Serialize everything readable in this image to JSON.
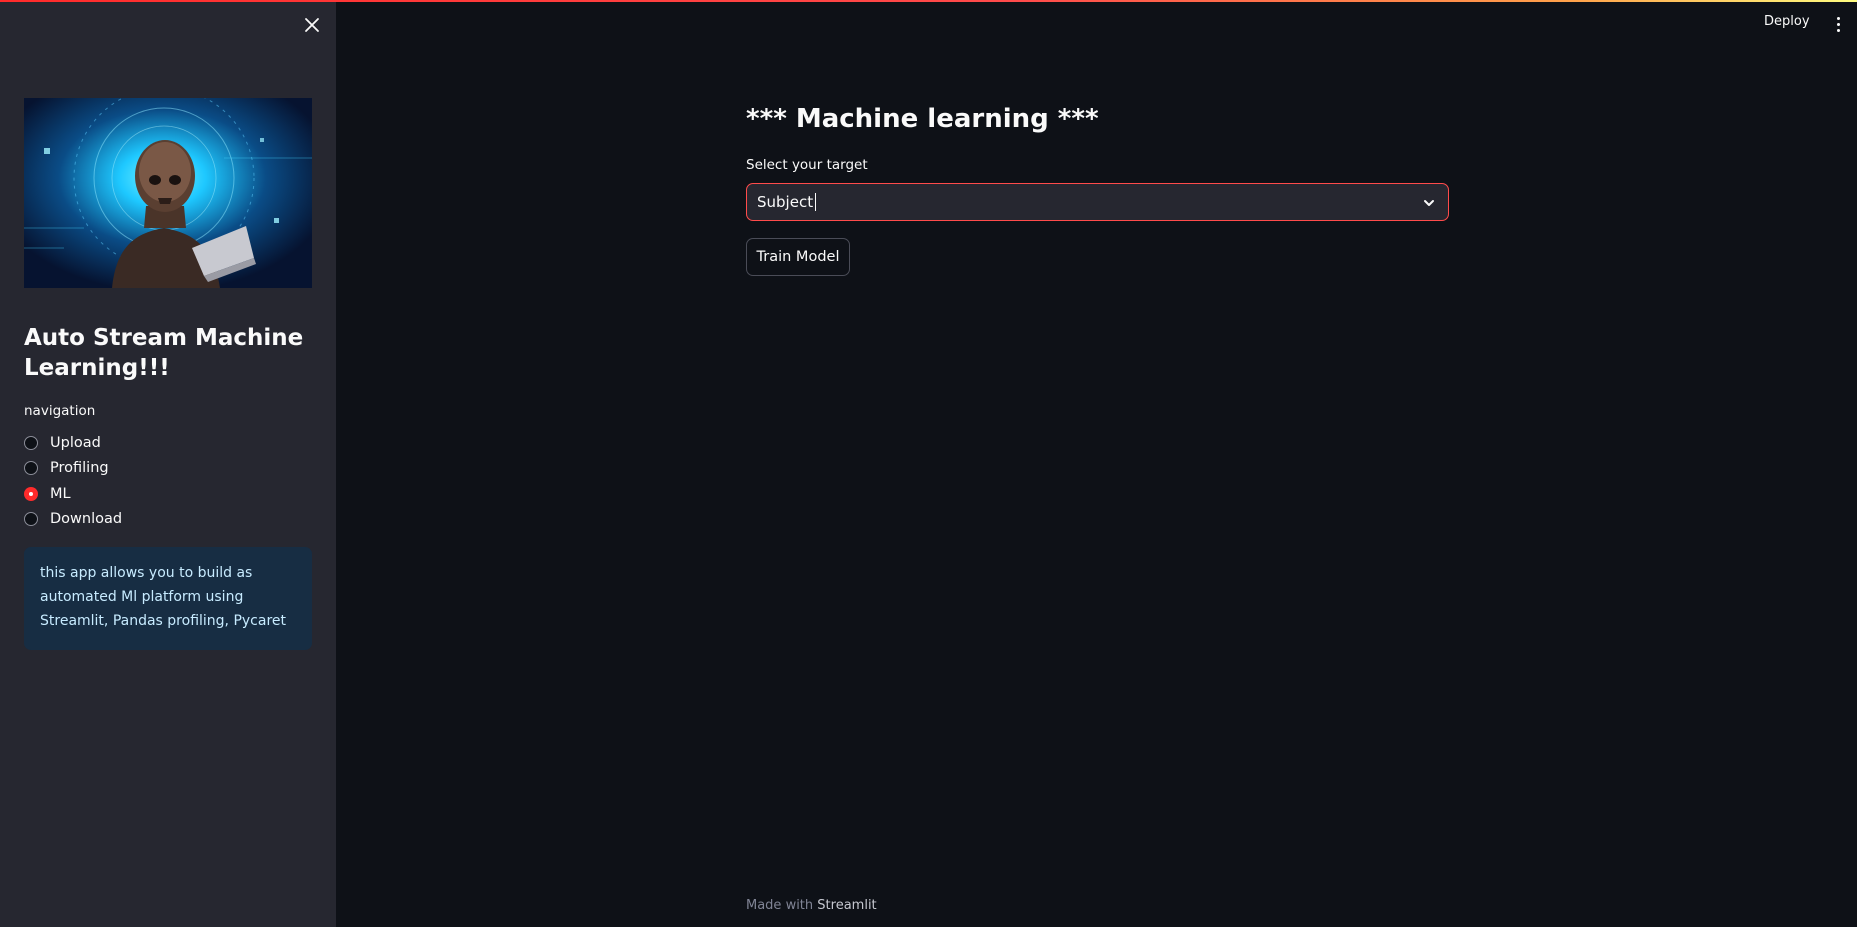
{
  "sidebar": {
    "title": "Auto Stream Machine Learning!!!",
    "nav_label": "navigation",
    "radio_options": [
      {
        "label": "Upload",
        "selected": false
      },
      {
        "label": "Profiling",
        "selected": false
      },
      {
        "label": "ML",
        "selected": true
      },
      {
        "label": "Download",
        "selected": false
      }
    ],
    "info_text": "this app allows you to build as automated Ml platform using Streamlit, Pandas profiling, Pycaret"
  },
  "header": {
    "deploy_label": "Deploy"
  },
  "main": {
    "title": "*** Machine learning ***",
    "select_label": "Select your target",
    "select_value": "Subject",
    "train_button": "Train Model"
  },
  "footer": {
    "prefix": "Made with",
    "brand": "Streamlit"
  },
  "colors": {
    "accent": "#ff4b4b",
    "background": "#0e1117",
    "sidebar": "#262730",
    "info_bg": "#172d43"
  }
}
